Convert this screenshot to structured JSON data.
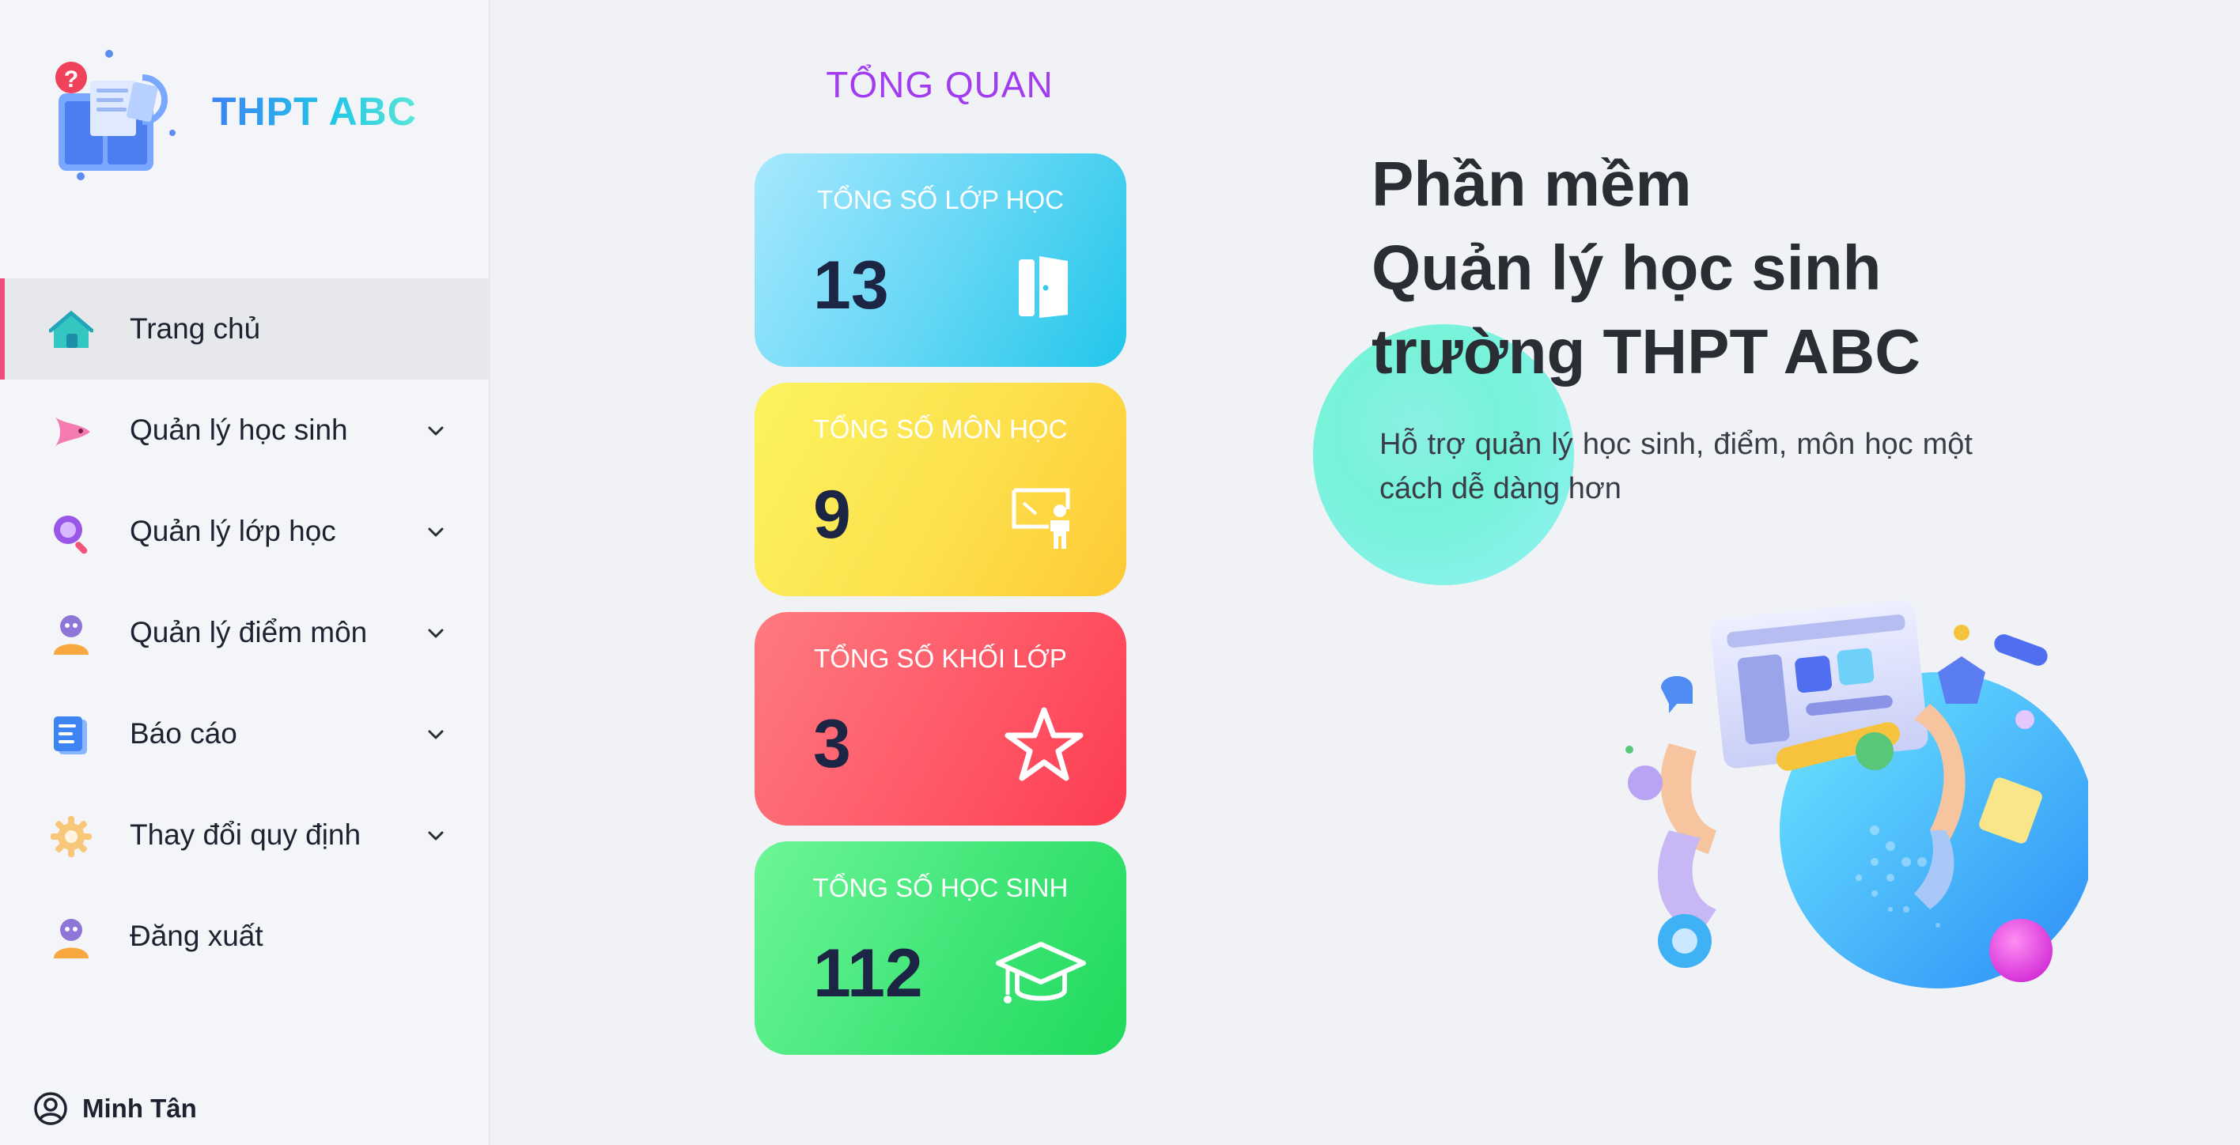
{
  "brand": {
    "name": "THPT ABC"
  },
  "sidebar": {
    "items": [
      {
        "label": "Trang chủ",
        "active": true,
        "has_children": false
      },
      {
        "label": "Quản lý học sinh",
        "active": false,
        "has_children": true
      },
      {
        "label": "Quản lý lớp học",
        "active": false,
        "has_children": true
      },
      {
        "label": "Quản lý điểm môn",
        "active": false,
        "has_children": true
      },
      {
        "label": "Báo cáo",
        "active": false,
        "has_children": true
      },
      {
        "label": "Thay đổi quy định",
        "active": false,
        "has_children": true
      },
      {
        "label": "Đăng xuất",
        "active": false,
        "has_children": false
      }
    ],
    "user": {
      "name": "Minh Tân"
    }
  },
  "overview": {
    "title": "TỔNG QUAN",
    "cards": [
      {
        "title": "TỔNG SỐ LỚP HỌC",
        "value": "13",
        "icon": "door-icon"
      },
      {
        "title": "TỔNG SỐ MÔN HỌC",
        "value": "9",
        "icon": "teacher-board-icon"
      },
      {
        "title": "TỔNG SỐ KHỐI LỚP",
        "value": "3",
        "icon": "star-icon"
      },
      {
        "title": "TỔNG SỐ HỌC SINH",
        "value": "112",
        "icon": "graduation-cap-icon"
      }
    ]
  },
  "hero": {
    "title_lines": [
      "Phần mềm",
      "Quản lý học sinh",
      "trường THPT ABC"
    ],
    "subtitle": "Hỗ trợ quản lý học sinh, điểm, môn học một cách dễ dàng hơn"
  },
  "colors": {
    "accent_pink": "#ee4d7d",
    "overview_title": "#a13cf0",
    "card_blue": "#22c6ea",
    "card_yellow": "#fec936",
    "card_red": "#fd3c51",
    "card_green": "#1fd95b"
  }
}
